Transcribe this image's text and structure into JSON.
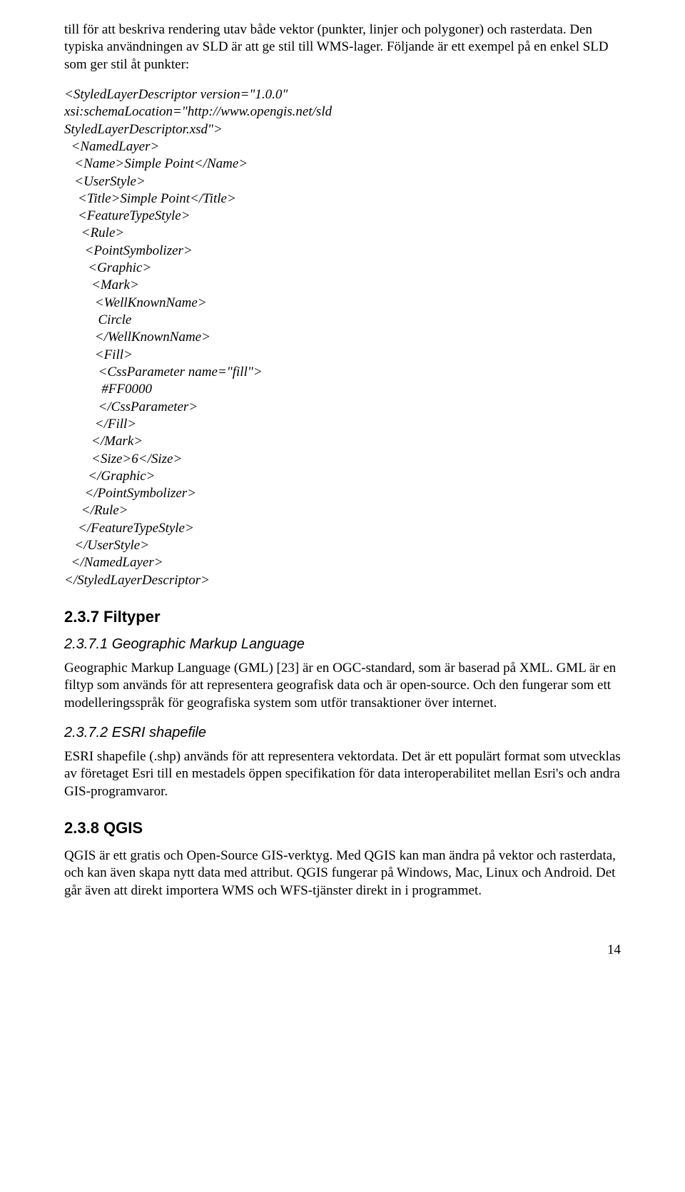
{
  "p_intro": "till för att beskriva rendering utav både vektor (punkter, linjer och polygoner) och rasterdata. Den typiska användningen av SLD är att ge stil till WMS-lager. Följande är ett exempel på en enkel SLD som ger stil åt punkter:",
  "code": "<StyledLayerDescriptor version=\"1.0.0\"\nxsi:schemaLocation=\"http://www.opengis.net/sld\nStyledLayerDescriptor.xsd\">\n  <NamedLayer>\n   <Name>Simple Point</Name>\n   <UserStyle>\n    <Title>Simple Point</Title>\n    <FeatureTypeStyle>\n     <Rule>\n      <PointSymbolizer>\n       <Graphic>\n        <Mark>\n         <WellKnownName>\n          Circle\n         </WellKnownName>\n         <Fill>\n          <CssParameter name=\"fill\">\n           #FF0000\n          </CssParameter>\n         </Fill>\n        </Mark>\n        <Size>6</Size>\n       </Graphic>\n      </PointSymbolizer>\n     </Rule>\n    </FeatureTypeStyle>\n   </UserStyle>\n  </NamedLayer>\n</StyledLayerDescriptor>",
  "h_237": "2.3.7 Filtyper",
  "h_2371": "2.3.7.1 Geographic Markup Language",
  "p_2371": "Geographic Markup Language (GML) [23] är en OGC-standard, som är baserad på XML. GML är en filtyp som används för att representera geografisk data och är open-source. Och den fungerar som ett modelleringsspråk för geografiska system som utför transaktioner över internet.",
  "h_2372": "2.3.7.2 ESRI shapefile",
  "p_2372": "ESRI shapefile (.shp) används för att representera vektordata. Det är ett populärt format som utvecklas av företaget Esri till en mestadels öppen specifikation för data interoperabilitet mellan Esri's och andra GIS-programvaror.",
  "h_238": "2.3.8 QGIS",
  "p_238": "QGIS är ett gratis och Open-Source GIS-verktyg. Med QGIS kan man ändra på vektor och rasterdata, och kan även skapa nytt data med attribut. QGIS fungerar på Windows, Mac, Linux och Android. Det går även att direkt importera WMS och WFS-tjänster direkt in i programmet.",
  "page_number": "14"
}
